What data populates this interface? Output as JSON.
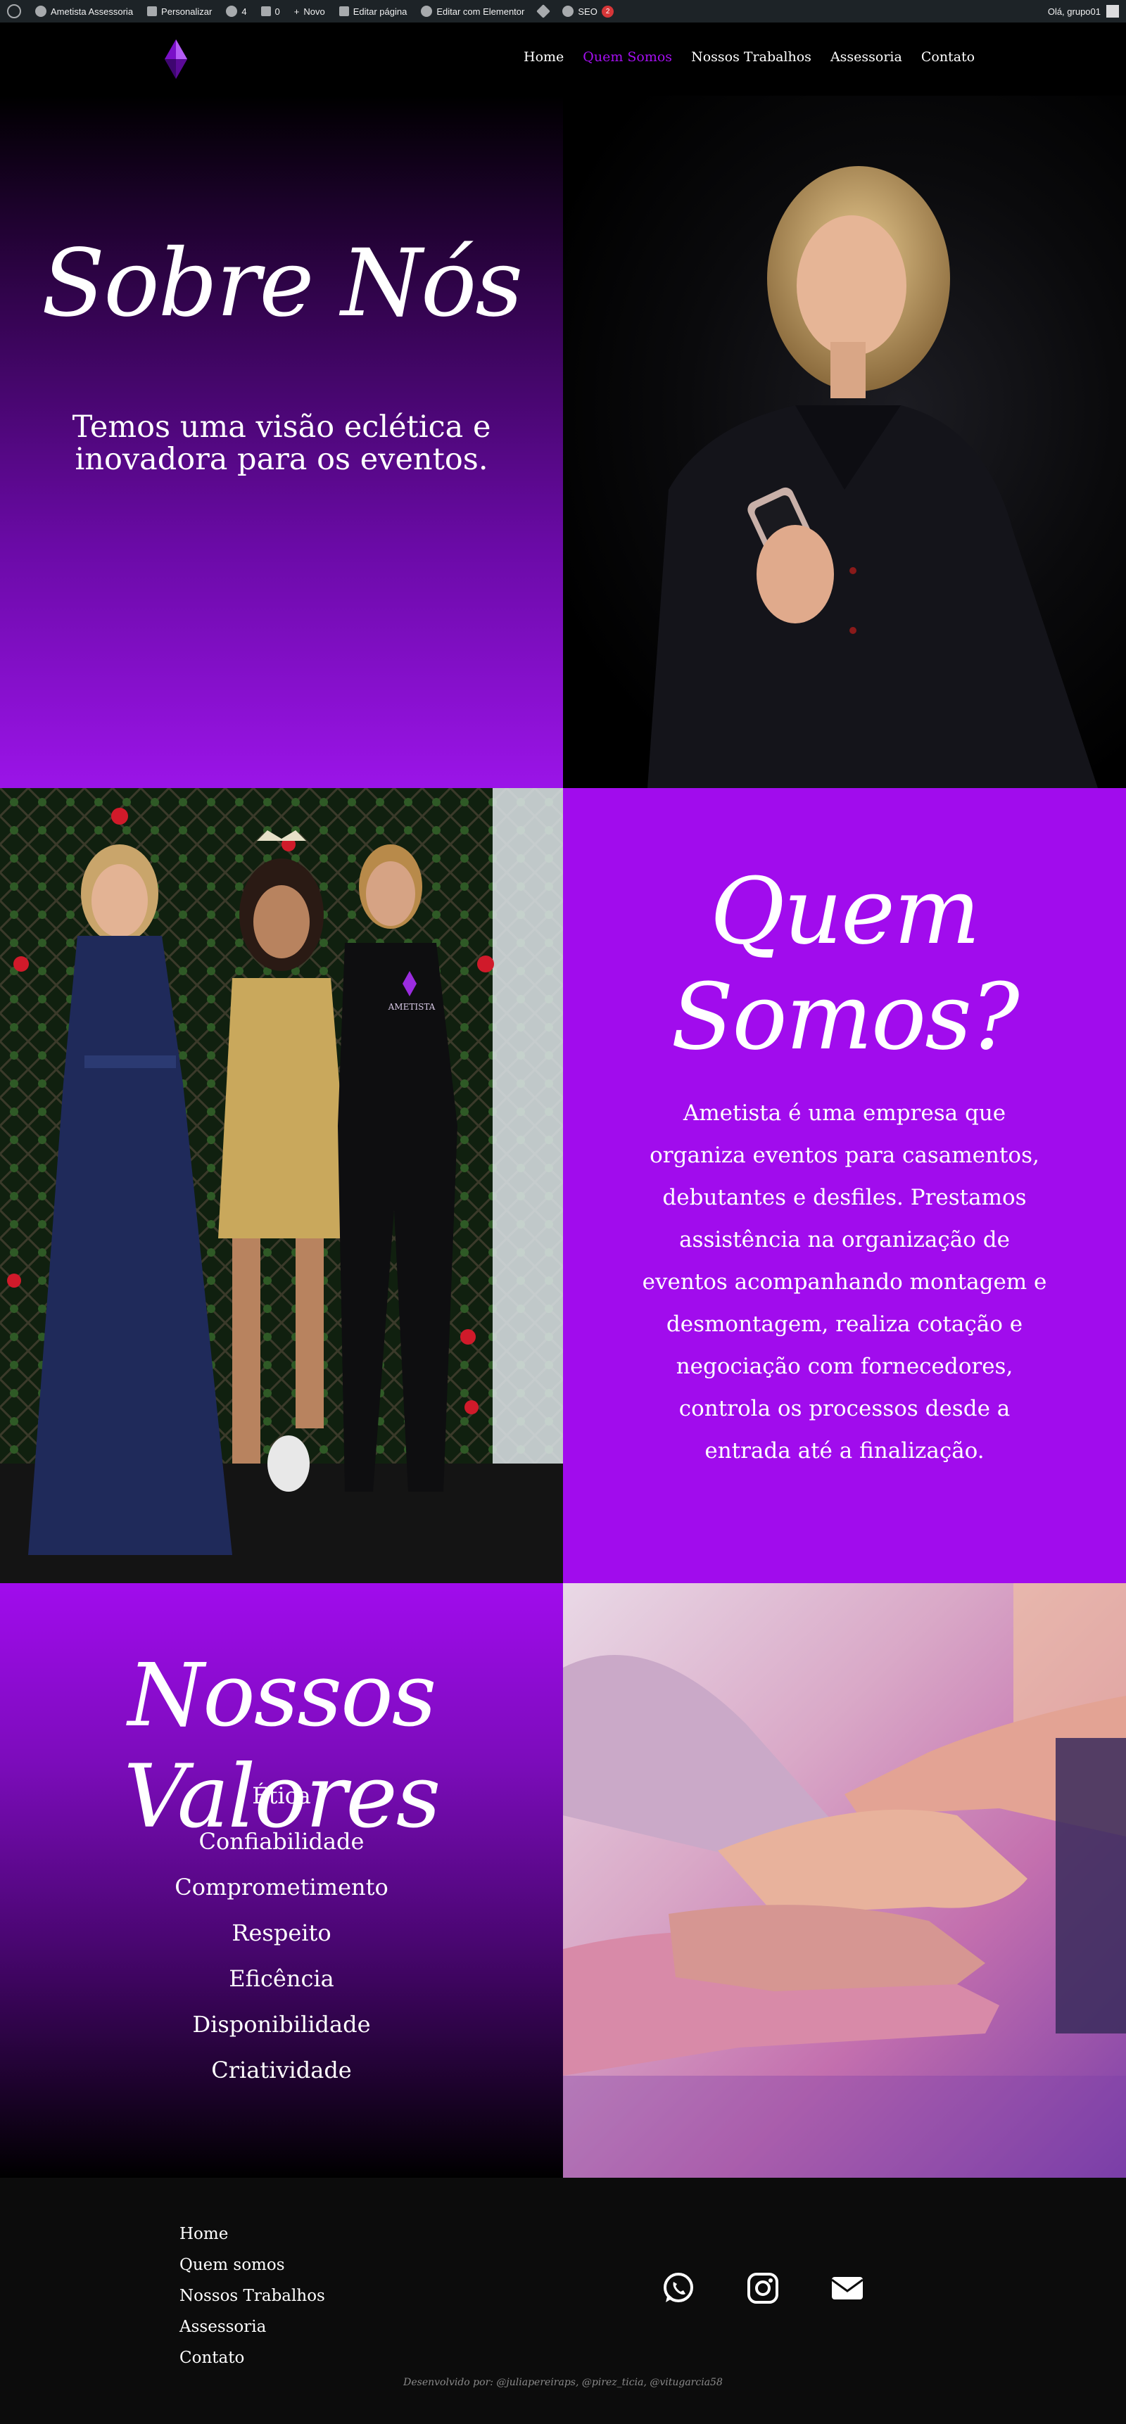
{
  "admin_bar": {
    "site": "Ametista Assessoria",
    "customize": "Personalizar",
    "updates": "4",
    "comments": "0",
    "new": "Novo",
    "edit_page": "Editar página",
    "edit_elementor": "Editar com Elementor",
    "seo": "SEO",
    "seo_badge": "2",
    "greeting": "Olá, grupo01"
  },
  "header": {
    "nav": [
      "Home",
      "Quem Somos",
      "Nossos Trabalhos",
      "Assessoria",
      "Contato"
    ],
    "active_color": "#a40ff0"
  },
  "about": {
    "title": "Sobre Nós",
    "subtitle": "Temos uma visão eclética e inovadora para os eventos."
  },
  "who": {
    "title": "Quem Somos?",
    "text": "Ametista  é uma empresa que organiza eventos para casamentos, debutantes e desfiles. Prestamos assistência na organização de eventos acompanhando montagem e desmontagem, realiza cotação e negociação com fornecedores, controla os processos desde a entrada até a finalização.",
    "shirt_logo": "AMETISTA"
  },
  "values": {
    "title": "Nossos Valores",
    "items": [
      "Ética",
      "Confiabilidade",
      "Comprometimento",
      "Respeito",
      "Eficência",
      "Disponibilidade",
      "Criatividade"
    ]
  },
  "footer": {
    "links": [
      "Home",
      "Quem somos",
      "Nossos Trabalhos",
      "Assessoria",
      "Contato"
    ],
    "credit": "Desenvolvido por: @juliapereiraps, @pirez_ticia, @vitugarcia58"
  },
  "colors": {
    "purple": "#a10ced",
    "footer": "#0c0c0c"
  }
}
